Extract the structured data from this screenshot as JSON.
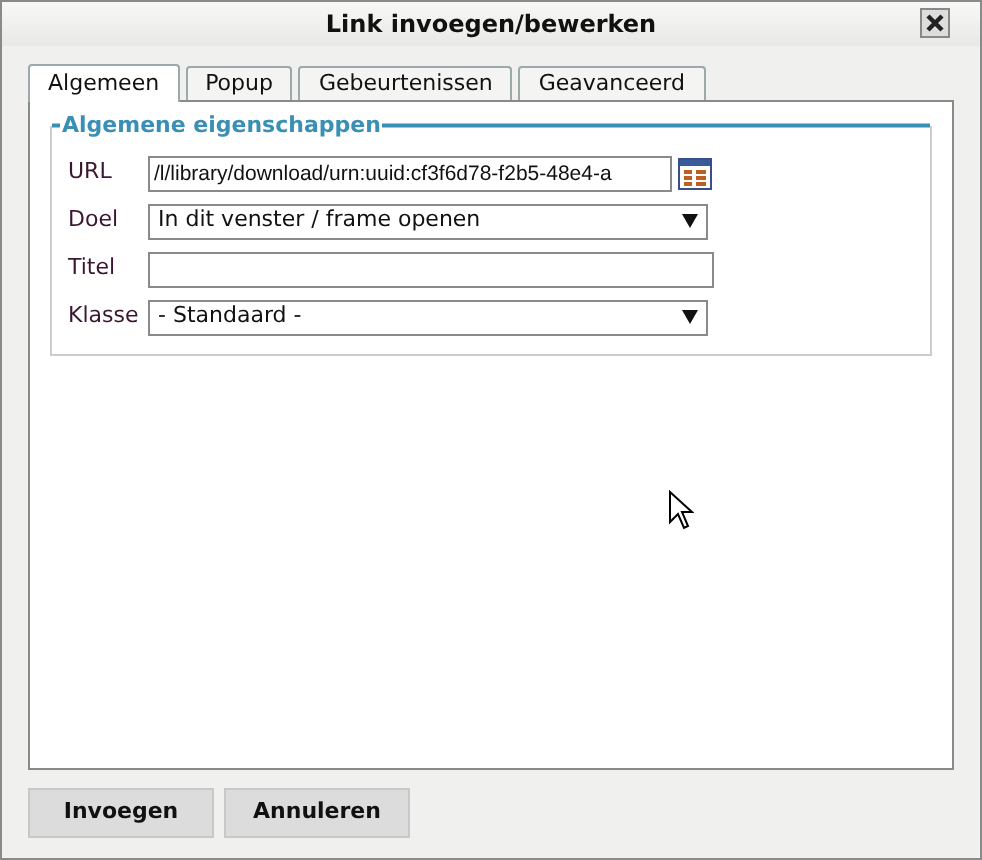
{
  "window": {
    "title": "Link invoegen/bewerken"
  },
  "tabs": [
    {
      "label": "Algemeen",
      "selected": true
    },
    {
      "label": "Popup",
      "selected": false
    },
    {
      "label": "Gebeurtenissen",
      "selected": false
    },
    {
      "label": "Geavanceerd",
      "selected": false
    }
  ],
  "fieldset": {
    "legend": "Algemene eigenschappen",
    "fields": [
      {
        "label": "URL",
        "kind": "input",
        "value": "/l/library/download/urn:uuid:cf3f6d78-f2b5-48e4-a",
        "browse": true
      },
      {
        "label": "Doel",
        "kind": "select",
        "value": "In dit venster / frame openen"
      },
      {
        "label": "Titel",
        "kind": "input"
      },
      {
        "label": "Klasse",
        "kind": "select",
        "value": "- Standaard -"
      }
    ]
  },
  "buttons": [
    "Invoegen",
    "Annuleren"
  ]
}
